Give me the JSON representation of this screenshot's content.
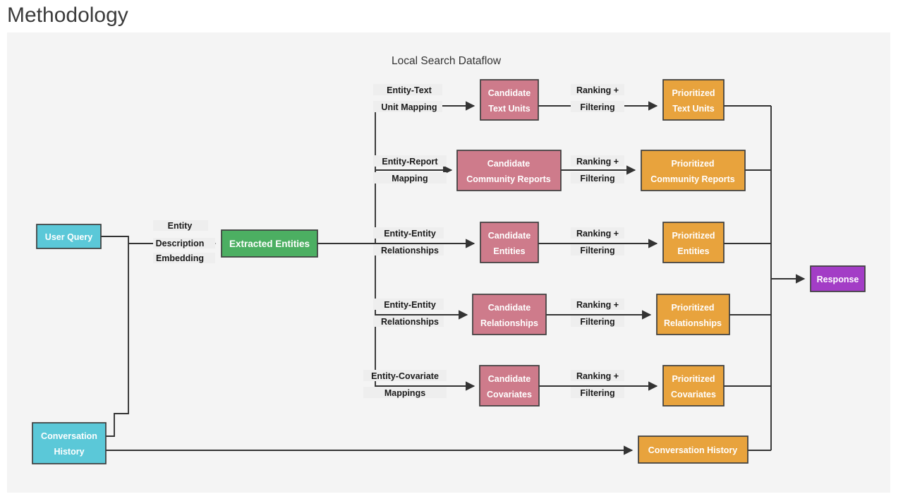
{
  "page": {
    "title": "Methodology",
    "background": "#ffffff",
    "canvas_background": "#f4f4f4"
  },
  "diagram": {
    "title": "Local Search Dataflow",
    "type": "flowchart",
    "colors": {
      "user_query": "#5BC8D8",
      "conversation_history": "#5BC8D8",
      "extracted_entities": "#4CAF62",
      "candidate": "#CE7B8B",
      "prioritized": "#E8A33D",
      "response": "#A33DC6",
      "edge": "#333333",
      "node_border": "#3d3d3d",
      "node_text": "#ffffff",
      "edge_text": "#1a1a1a"
    },
    "nodes": {
      "user_query": {
        "label": "User Query",
        "color": "#5BC8D8"
      },
      "conversation_history_left": {
        "label_line1": "Conversation",
        "label_line2": "History",
        "color": "#5BC8D8"
      },
      "extracted_entities": {
        "label": "Extracted Entities",
        "color": "#4CAF62"
      },
      "response": {
        "label": "Response",
        "color": "#A33DC6"
      },
      "conversation_history_right": {
        "label": "Conversation History",
        "color": "#E8A33D"
      }
    },
    "edge_labels": {
      "entity_description_embedding": [
        "Entity",
        "Description",
        "Embedding"
      ],
      "ranking_filtering": [
        "Ranking +",
        "Filtering"
      ]
    },
    "rows": [
      {
        "id": "text-units",
        "mapping_label": [
          "Entity-Text",
          "Unit Mapping"
        ],
        "candidate": {
          "lines": [
            "Candidate",
            "Text Units"
          ],
          "color": "#CE7B8B"
        },
        "ranking_label": [
          "Ranking +",
          "Filtering"
        ],
        "prioritized": {
          "lines": [
            "Prioritized",
            "Text Units"
          ],
          "color": "#E8A33D"
        }
      },
      {
        "id": "community-reports",
        "mapping_label": [
          "Entity-Report",
          "Mapping"
        ],
        "candidate": {
          "lines": [
            "Candidate",
            "Community Reports"
          ],
          "color": "#CE7B8B"
        },
        "ranking_label": [
          "Ranking +",
          "Filtering"
        ],
        "prioritized": {
          "lines": [
            "Prioritized",
            "Community Reports"
          ],
          "color": "#E8A33D"
        }
      },
      {
        "id": "entities",
        "mapping_label": [
          "Entity-Entity",
          "Relationships"
        ],
        "candidate": {
          "lines": [
            "Candidate",
            "Entities"
          ],
          "color": "#CE7B8B"
        },
        "ranking_label": [
          "Ranking +",
          "Filtering"
        ],
        "prioritized": {
          "lines": [
            "Prioritized",
            "Entities"
          ],
          "color": "#E8A33D"
        }
      },
      {
        "id": "relationships",
        "mapping_label": [
          "Entity-Entity",
          "Relationships"
        ],
        "candidate": {
          "lines": [
            "Candidate",
            "Relationships"
          ],
          "color": "#CE7B8B"
        },
        "ranking_label": [
          "Ranking +",
          "Filtering"
        ],
        "prioritized": {
          "lines": [
            "Prioritized",
            "Relationships"
          ],
          "color": "#E8A33D"
        }
      },
      {
        "id": "covariates",
        "mapping_label": [
          "Entity-Covariate",
          "Mappings"
        ],
        "candidate": {
          "lines": [
            "Candidate",
            "Covariates"
          ],
          "color": "#CE7B8B"
        },
        "ranking_label": [
          "Ranking +",
          "Filtering"
        ],
        "prioritized": {
          "lines": [
            "Prioritized",
            "Covariates"
          ],
          "color": "#E8A33D"
        }
      }
    ]
  }
}
